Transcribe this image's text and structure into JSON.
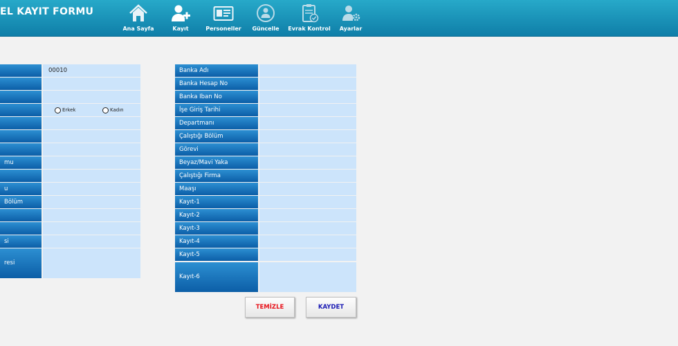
{
  "app": {
    "title": "EL KAYIT FORMU"
  },
  "nav": [
    {
      "label": "Ana Sayfa",
      "icon": "home-icon"
    },
    {
      "label": "Kayıt",
      "icon": "add-user-icon"
    },
    {
      "label": "Personeller",
      "icon": "id-card-icon"
    },
    {
      "label": "Güncelle",
      "icon": "refresh-user-icon"
    },
    {
      "label": "Evrak Kontrol",
      "icon": "clipboard-check-icon"
    },
    {
      "label": "Ayarlar",
      "icon": "user-gear-icon"
    }
  ],
  "left": {
    "value_0": "00010",
    "labels": [
      "",
      "",
      "",
      "",
      "",
      "",
      "",
      "mu",
      "",
      "u",
      " Bölüm",
      "",
      "",
      "si",
      "resi"
    ],
    "gender": {
      "male": "Erkek",
      "female": "Kadın"
    }
  },
  "right": {
    "labels": [
      "Banka Adı",
      "Banka Hesap No",
      "Banka Iban No",
      "İşe Giriş Tarihi",
      "Departmanı",
      "Çalıştığı Bölüm",
      "Görevi",
      "Beyaz/Mavi Yaka",
      "Çalıştığı Firma",
      "Maaşı",
      "Kayıt-1",
      "Kayıt-2",
      "Kayıt-3",
      "Kayıt-4",
      "Kayıt-5",
      "Kayıt-6"
    ]
  },
  "buttons": {
    "clear": "TEMİZLE",
    "save": "KAYDET"
  },
  "colors": {
    "header": "#1a93bb",
    "label_bg": "#1a74c0",
    "field_bg": "#cce4fb",
    "clear_text": "#e8141c",
    "save_text": "#1a1ab4"
  }
}
